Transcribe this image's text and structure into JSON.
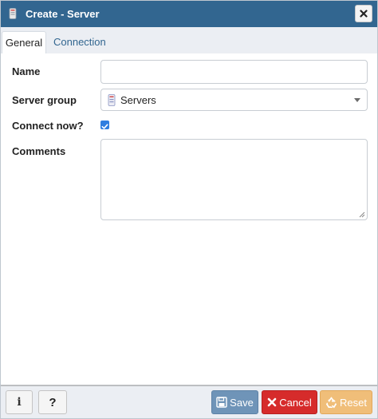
{
  "window": {
    "title": "Create - Server",
    "close_icon": "close-icon"
  },
  "tabs": [
    {
      "label": "General",
      "active": true
    },
    {
      "label": "Connection",
      "active": false
    }
  ],
  "form": {
    "name": {
      "label": "Name",
      "value": ""
    },
    "server_group": {
      "label": "Server group",
      "value": "Servers",
      "icon": "server-group-icon"
    },
    "connect_now": {
      "label": "Connect now?",
      "checked": true
    },
    "comments": {
      "label": "Comments",
      "value": ""
    }
  },
  "footer": {
    "info_label": "i",
    "help_label": "?",
    "save_label": "Save",
    "cancel_label": "Cancel",
    "reset_label": "Reset"
  },
  "colors": {
    "titlebar": "#326690",
    "save": "#6f94b8",
    "cancel": "#d62b2b",
    "reset": "#f0be79",
    "checkbox": "#2f7ee0"
  }
}
